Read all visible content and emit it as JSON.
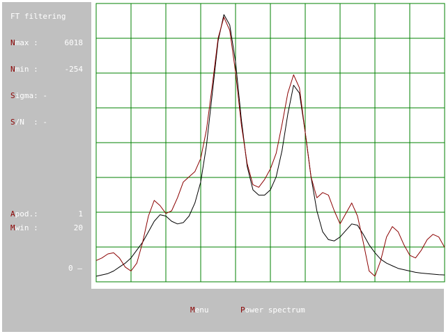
{
  "panel": {
    "title": "FT filtering",
    "nmax": {
      "hotkey": "N",
      "label": "max :",
      "value": "6018"
    },
    "nmin": {
      "hotkey": "N",
      "label": "min :",
      "value": "-254"
    },
    "sigma": {
      "hotkey": "S",
      "label": "igma: -"
    },
    "sn": {
      "hotkey": "S",
      "label": "/N  : -"
    },
    "apod": {
      "hotkey": "A",
      "label": "pod.:",
      "value": "1"
    },
    "mwin": {
      "hotkey": "M",
      "label": "win :",
      "value": "20"
    },
    "zero_label": "0 —"
  },
  "menu": {
    "menu": {
      "hotkey": "M",
      "label": "enu"
    },
    "power": {
      "hotkey": "P",
      "label": "ower spectrum"
    }
  },
  "colors": {
    "grid": "#008000",
    "raw_curve": "#000000",
    "filtered_curve": "#8b0000",
    "panel_bg": "#c0c0c0"
  },
  "chart_data": {
    "type": "line",
    "grid": true,
    "series": [
      {
        "values": [
          0.0,
          0.005,
          0.01,
          0.02,
          0.035,
          0.05,
          0.07,
          0.1,
          0.13,
          0.17,
          0.21,
          0.235,
          0.23,
          0.21,
          0.2,
          0.205,
          0.23,
          0.28,
          0.36,
          0.5,
          0.7,
          0.9,
          1.0,
          0.96,
          0.82,
          0.6,
          0.42,
          0.33,
          0.31,
          0.31,
          0.33,
          0.38,
          0.48,
          0.62,
          0.73,
          0.7,
          0.55,
          0.38,
          0.25,
          0.17,
          0.14,
          0.135,
          0.15,
          0.175,
          0.2,
          0.195,
          0.16,
          0.12,
          0.09,
          0.065,
          0.05,
          0.04,
          0.03,
          0.025,
          0.02,
          0.015,
          0.012,
          0.01,
          0.008,
          0.006,
          0.005
        ]
      },
      {
        "values": [
          0.06,
          0.07,
          0.085,
          0.09,
          0.07,
          0.035,
          0.02,
          0.05,
          0.13,
          0.23,
          0.29,
          0.27,
          0.24,
          0.25,
          0.3,
          0.36,
          0.38,
          0.4,
          0.45,
          0.56,
          0.73,
          0.91,
          0.99,
          0.94,
          0.78,
          0.58,
          0.43,
          0.35,
          0.34,
          0.37,
          0.41,
          0.47,
          0.58,
          0.7,
          0.77,
          0.72,
          0.55,
          0.38,
          0.3,
          0.32,
          0.31,
          0.25,
          0.2,
          0.24,
          0.28,
          0.23,
          0.13,
          0.02,
          0.0,
          0.06,
          0.15,
          0.19,
          0.17,
          0.12,
          0.08,
          0.07,
          0.1,
          0.14,
          0.16,
          0.15,
          0.11
        ]
      }
    ]
  }
}
